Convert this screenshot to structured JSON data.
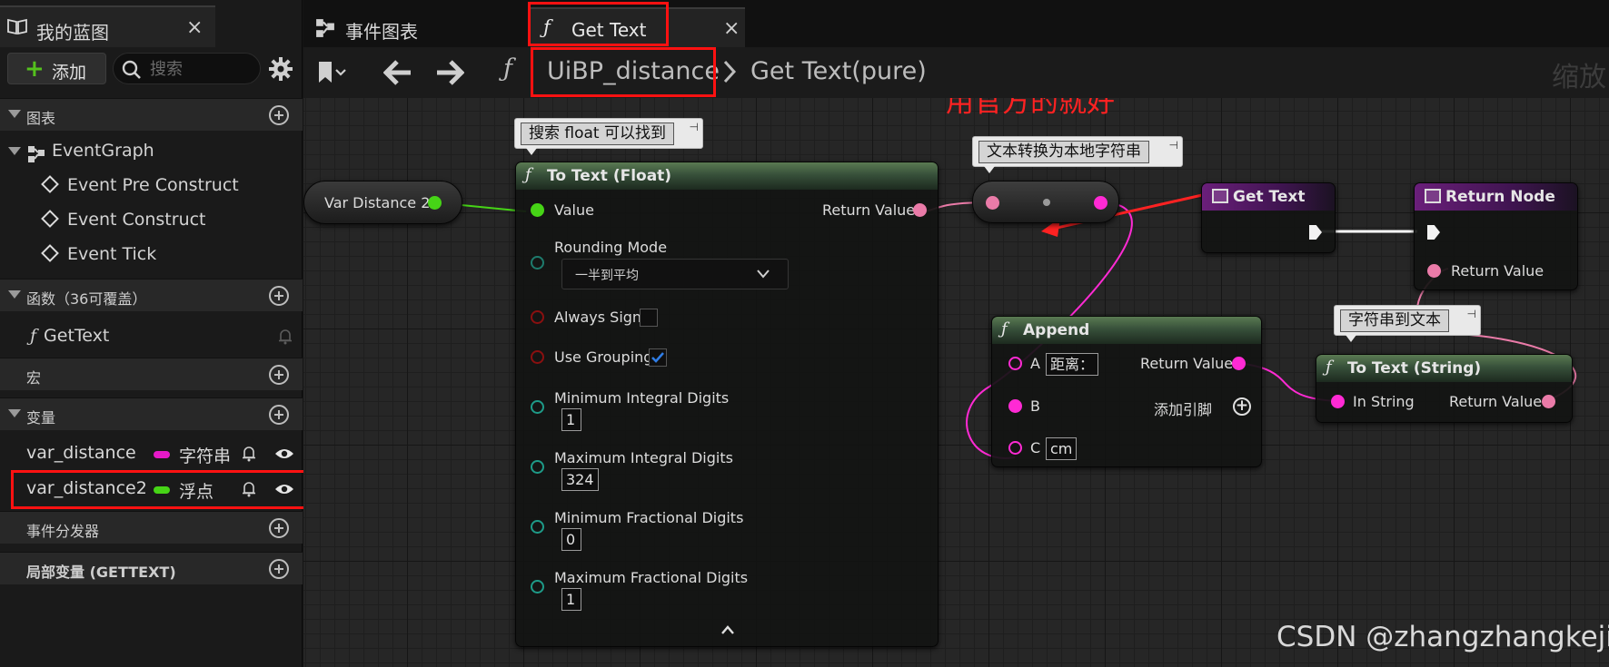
{
  "left_panel": {
    "tab_title": "我的蓝图",
    "close": "×",
    "add_label": "添加",
    "search_placeholder": "搜索",
    "sections": {
      "graphs": "图表",
      "functions": "函数（36可覆盖）",
      "macros": "宏",
      "variables": "变量",
      "dispatchers": "事件分发器",
      "locals": "局部变量 (GETTEXT)"
    },
    "event_graph": "EventGraph",
    "events": [
      "Event Pre Construct",
      "Event Construct",
      "Event Tick"
    ],
    "functions": [
      {
        "f": "ƒ",
        "name": "GetText"
      }
    ],
    "variables": [
      {
        "name": "var_distance",
        "type": "字符串",
        "color": "#e619c8"
      },
      {
        "name": "var_distance2",
        "type": "浮点",
        "color": "#46d416"
      }
    ]
  },
  "tabs": [
    {
      "title": "事件图表"
    },
    {
      "f": "ƒ",
      "title": "Get Text",
      "close": "×"
    }
  ],
  "toolbar": {
    "f": "ƒ",
    "class_name": "UiBP_distance",
    "function_name": "Get Text(pure)",
    "zoom_label": "缩放"
  },
  "graph": {
    "annotation": "用官方的就好",
    "comments": {
      "float": "搜索 float 可以找到",
      "local": "文本转换为本地字符串",
      "str2text": "字符串到文本"
    },
    "var_node": {
      "label": "Var Distance 2"
    },
    "to_text_float": {
      "f": "ƒ",
      "title": "To Text (Float)",
      "value": "Value",
      "return_value": "Return Value",
      "rounding_mode": "Rounding Mode",
      "rounding_value": "一半到平均",
      "always_sign": "Always Sign",
      "use_grouping": "Use Grouping",
      "min_integral": "Minimum Integral Digits",
      "min_integral_val": "1",
      "max_integral": "Maximum Integral Digits",
      "max_integral_val": "324",
      "min_frac": "Minimum Fractional Digits",
      "min_frac_val": "0",
      "max_frac": "Maximum Fractional Digits",
      "max_frac_val": "1"
    },
    "append": {
      "f": "ƒ",
      "title": "Append",
      "a": "A",
      "a_val": "距离：",
      "b": "B",
      "c": "C",
      "c_val": "cm",
      "return_value": "Return Value",
      "add_pin": "添加引脚"
    },
    "to_text_string": {
      "f": "ƒ",
      "title": "To Text (String)",
      "in_string": "In String",
      "return_value": "Return Value"
    },
    "get_text": {
      "title": "Get Text"
    },
    "return_node": {
      "title": "Return Node",
      "return_value": "Return Value"
    },
    "colors": {
      "float_pin": "#46d416",
      "string_pin": "#ff2ad4",
      "text_pin": "#ea7ba8",
      "byte_pin": "#1e7b6d",
      "bool_pin": "#8a1010"
    }
  },
  "watermark": "CSDN @zhangzhangkeji"
}
